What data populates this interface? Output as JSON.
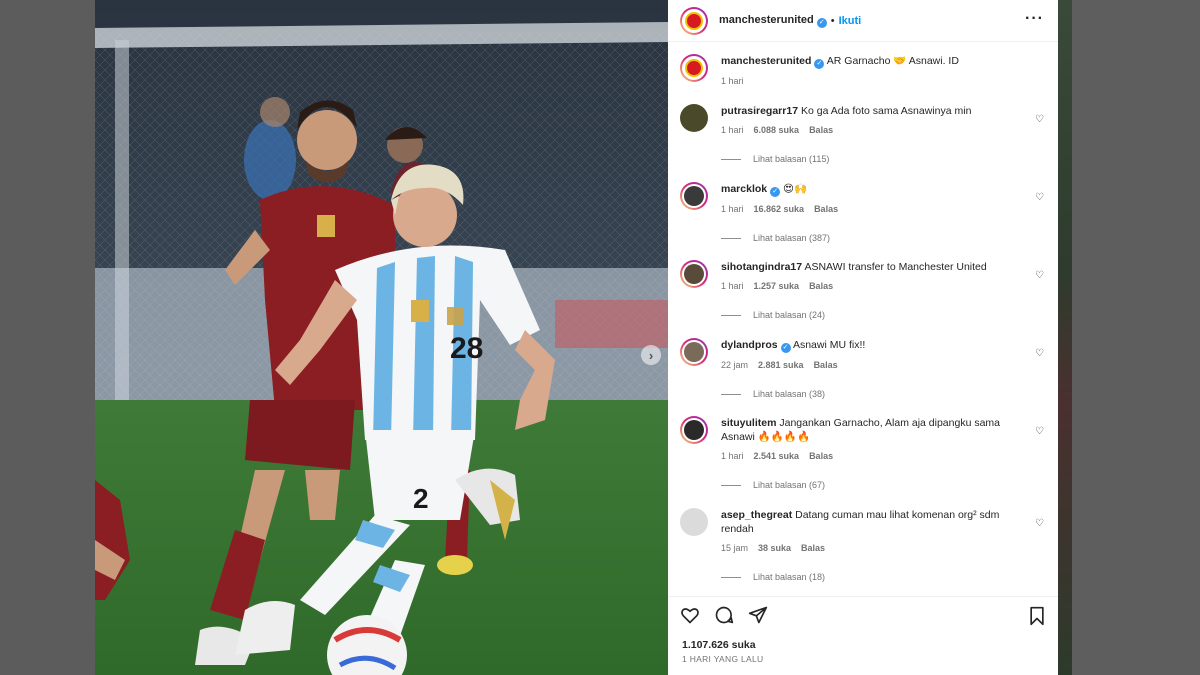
{
  "post": {
    "author": "manchesterunited",
    "follow_label": "Ikuti",
    "separator": "•",
    "more_icon": "more-horizontal-icon",
    "caption_text": "AR Garnacho 🤝 Asnawi. ID",
    "caption_time": "1 hari",
    "likes": "1.107.626 suka",
    "posted": "1 HARI YANG LALU"
  },
  "photo": {
    "player_number": "28",
    "next_icon": "chevron-right-icon"
  },
  "comments": [
    {
      "user": "putrasiregarr17",
      "verified": false,
      "text": "Ko ga Ada foto sama Asnawinya min",
      "time": "1 hari",
      "likes": "6.088 suka",
      "reply": "Balas",
      "replies": "Lihat balasan (115)"
    },
    {
      "user": "marcklok",
      "verified": true,
      "text": "😍🙌",
      "time": "1 hari",
      "likes": "16.862 suka",
      "reply": "Balas",
      "replies": "Lihat balasan (387)"
    },
    {
      "user": "sihotangindra17",
      "verified": false,
      "text": "ASNAWI transfer to Manchester United",
      "time": "1 hari",
      "likes": "1.257 suka",
      "reply": "Balas",
      "replies": "Lihat balasan (24)"
    },
    {
      "user": "dylandpros",
      "verified": true,
      "text": "Asnawi MU fix!!",
      "time": "22 jam",
      "likes": "2.881 suka",
      "reply": "Balas",
      "replies": "Lihat balasan (38)"
    },
    {
      "user": "situyulitem",
      "verified": false,
      "text": "Jangankan Garnacho, Alam aja dipangku sama Asnawi 🔥🔥🔥🔥",
      "time": "1 hari",
      "likes": "2.541 suka",
      "reply": "Balas",
      "replies": "Lihat balasan (67)"
    },
    {
      "user": "asep_thegreat",
      "verified": false,
      "text": "Datang cuman mau lihat komenan org² sdm rendah",
      "time": "15 jam",
      "likes": "38 suka",
      "reply": "Balas",
      "replies": "Lihat balasan (18)"
    }
  ],
  "icons": {
    "like": "heart-icon",
    "comment": "comment-icon",
    "share": "share-icon",
    "save": "bookmark-icon"
  },
  "colors": {
    "accent": "#0095f6",
    "verified": "#3897f0",
    "indonesia_red": "#8b1e22",
    "argentina_blue": "#6cb4e4"
  }
}
